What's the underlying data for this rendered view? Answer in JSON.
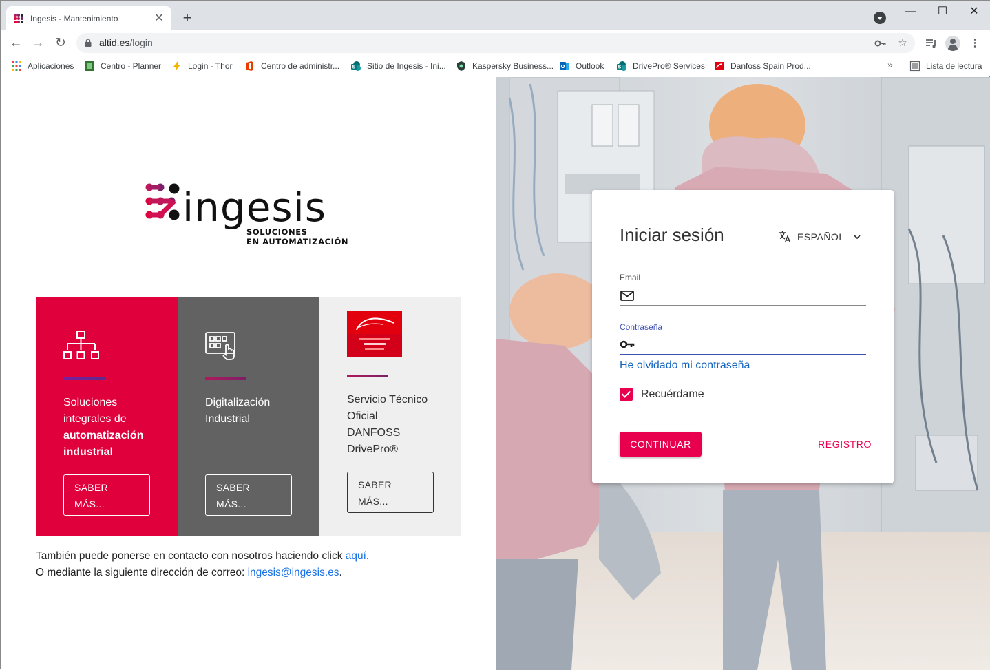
{
  "browser": {
    "tab_title": "Ingesis - Mantenimiento",
    "tab_close": "✕",
    "new_tab": "+",
    "url_host": "altid.es",
    "url_path": "/login",
    "controls": {
      "minimize": "—",
      "maximize": "☐",
      "close": "✕"
    },
    "bookmarks": [
      {
        "label": "Aplicaciones",
        "icon": "apps-grid-icon"
      },
      {
        "label": "Centro - Planner",
        "icon": "planner-icon"
      },
      {
        "label": "Login - Thor",
        "icon": "bolt-icon"
      },
      {
        "label": "Centro de administr...",
        "icon": "office-icon"
      },
      {
        "label": "Sitio de Ingesis - Ini...",
        "icon": "sharepoint-icon"
      },
      {
        "label": "Kaspersky Business...",
        "icon": "kaspersky-icon"
      },
      {
        "label": "Outlook",
        "icon": "outlook-icon"
      },
      {
        "label": "DrivePro® Services",
        "icon": "sharepoint-icon"
      },
      {
        "label": "Danfoss Spain Prod...",
        "icon": "danfoss-icon"
      }
    ],
    "bookmarks_more": "»",
    "reading_list": "Lista de lectura"
  },
  "brand": {
    "name": "ingesis",
    "tagline_1": "SOLUCIONES",
    "tagline_2": "EN AUTOMATIZACIÓN",
    "accent": "#e0003c"
  },
  "cards": [
    {
      "text_1": "Soluciones integrales de",
      "text_bold": "automatización industrial",
      "button_1": "SABER",
      "button_2": "MÁS...",
      "icon": "org-chart-icon"
    },
    {
      "text_1": "Digitalización Industrial",
      "button_1": "SABER",
      "button_2": "MÁS...",
      "icon": "touch-panel-icon"
    },
    {
      "text_1": "Servicio Técnico Oficial DANFOSS DrivePro®",
      "button_1": "SABER",
      "button_2": "MÁS...",
      "icon": "danfoss-logo-icon"
    }
  ],
  "contact": {
    "line1_text": "También puede ponerse en contacto con nosotros haciendo click ",
    "line1_link": "aquí",
    "line1_end": ".",
    "line2_text": "O mediante la siguiente dirección de correo: ",
    "line2_link": "ingesis@ingesis.es",
    "line2_end": "."
  },
  "login": {
    "title": "Iniciar sesión",
    "language": "ESPAÑOL",
    "email_label": "Email",
    "email_value": "",
    "password_label": "Contraseña",
    "password_value": "",
    "forgot": "He olvidado mi contraseña",
    "remember": "Recuérdame",
    "remember_checked": true,
    "continue": "CONTINUAR",
    "register": "REGISTRO"
  }
}
